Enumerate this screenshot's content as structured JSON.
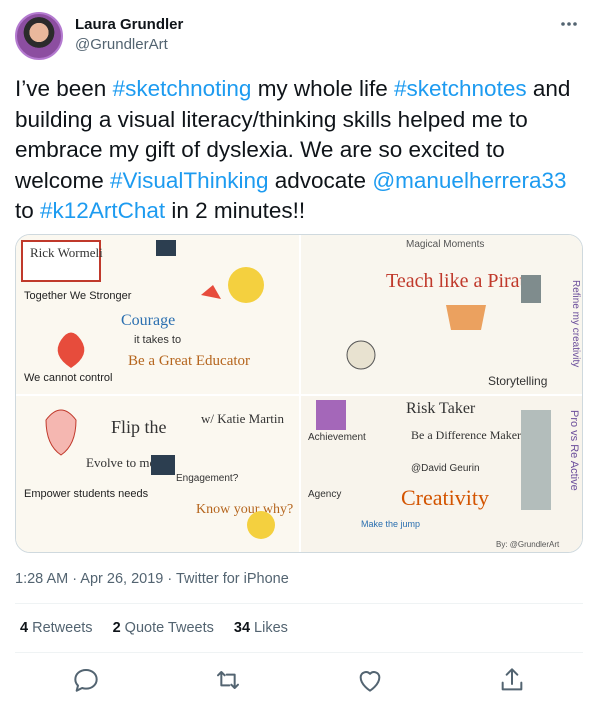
{
  "author": {
    "display_name": "Laura Grundler",
    "handle": "@GrundlerArt"
  },
  "tweet": {
    "segments": [
      {
        "text": "I’ve been ",
        "link": false
      },
      {
        "text": "#sketchnoting",
        "link": true
      },
      {
        "text": " my whole life ",
        "link": false
      },
      {
        "text": "#sketchnotes",
        "link": true
      },
      {
        "text": " and building a visual literacy/thinking skills helped me to embrace my gift of dyslexia.  We are so excited to welcome ",
        "link": false
      },
      {
        "text": "#VisualThinking",
        "link": true
      },
      {
        "text": " advocate ",
        "link": false
      },
      {
        "text": "@manuelherrera33",
        "link": true
      },
      {
        "text": " to ",
        "link": false
      },
      {
        "text": "#k12ArtChat",
        "link": true
      },
      {
        "text": " in 2 minutes!!",
        "link": false
      }
    ]
  },
  "media": {
    "panels": [
      {
        "labels": [
          "Rick Wormeli",
          "Together We Stronger",
          "Courage",
          "it takes to",
          "Be a Great Educator",
          "We cannot control"
        ]
      },
      {
        "labels": [
          "Teach like a Pirate",
          "Storytelling",
          "Magical Moments",
          "Refine my creativity"
        ]
      },
      {
        "labels": [
          "Flip the",
          "w/ Katie Martin",
          "Evolve to meet",
          "Empower students needs",
          "Know your why?",
          "Engagement?"
        ]
      },
      {
        "labels": [
          "Risk Taker",
          "Be a Difference Maker",
          "@David Geurin",
          "Creativity",
          "Achievement",
          "Agency",
          "Make the jump",
          "Pro vs Re Active"
        ]
      }
    ],
    "signature": "By: @GrundlerArt"
  },
  "meta": {
    "time": "1:28 AM",
    "separator1": " · ",
    "date": "Apr 26, 2019",
    "separator2": " · ",
    "source": "Twitter for iPhone"
  },
  "stats": {
    "retweets_count": "4",
    "retweets_label": " Retweets",
    "quotes_count": "2",
    "quotes_label": " Quote Tweets",
    "likes_count": "34",
    "likes_label": " Likes"
  },
  "icons": {
    "more": "more-horizontal-icon",
    "reply": "reply-icon",
    "retweet": "retweet-icon",
    "like": "heart-icon",
    "share": "share-icon"
  },
  "colors": {
    "link": "#1d9bf0",
    "text": "#0f1419",
    "secondary": "#536471"
  }
}
